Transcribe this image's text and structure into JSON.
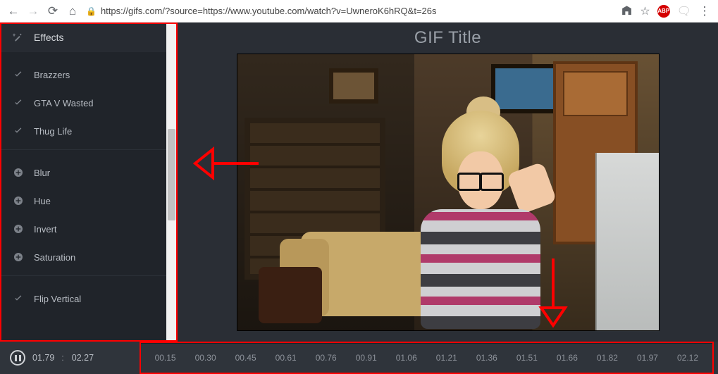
{
  "browser": {
    "url": "https://gifs.com/?source=https://www.youtube.com/watch?v=UwneroK6hRQ&t=26s",
    "hostname": "gifs.com",
    "abp": "ABP"
  },
  "sidebar": {
    "header": "Effects",
    "group1": [
      {
        "label": "Brazzers"
      },
      {
        "label": "GTA V Wasted"
      },
      {
        "label": "Thug Life"
      }
    ],
    "group2": [
      {
        "label": "Blur"
      },
      {
        "label": "Hue"
      },
      {
        "label": "Invert"
      },
      {
        "label": "Saturation"
      }
    ],
    "group3": [
      {
        "label": "Flip Vertical"
      }
    ]
  },
  "preview": {
    "title_placeholder": "GIF Title"
  },
  "playbar": {
    "current": "01.79",
    "sep": ":",
    "duration": "02.27"
  },
  "timeline": {
    "ticks": [
      "00.15",
      "00.30",
      "00.45",
      "00.61",
      "00.76",
      "00.91",
      "01.06",
      "01.21",
      "01.36",
      "01.51",
      "01.66",
      "01.82",
      "01.97",
      "02.12"
    ]
  }
}
